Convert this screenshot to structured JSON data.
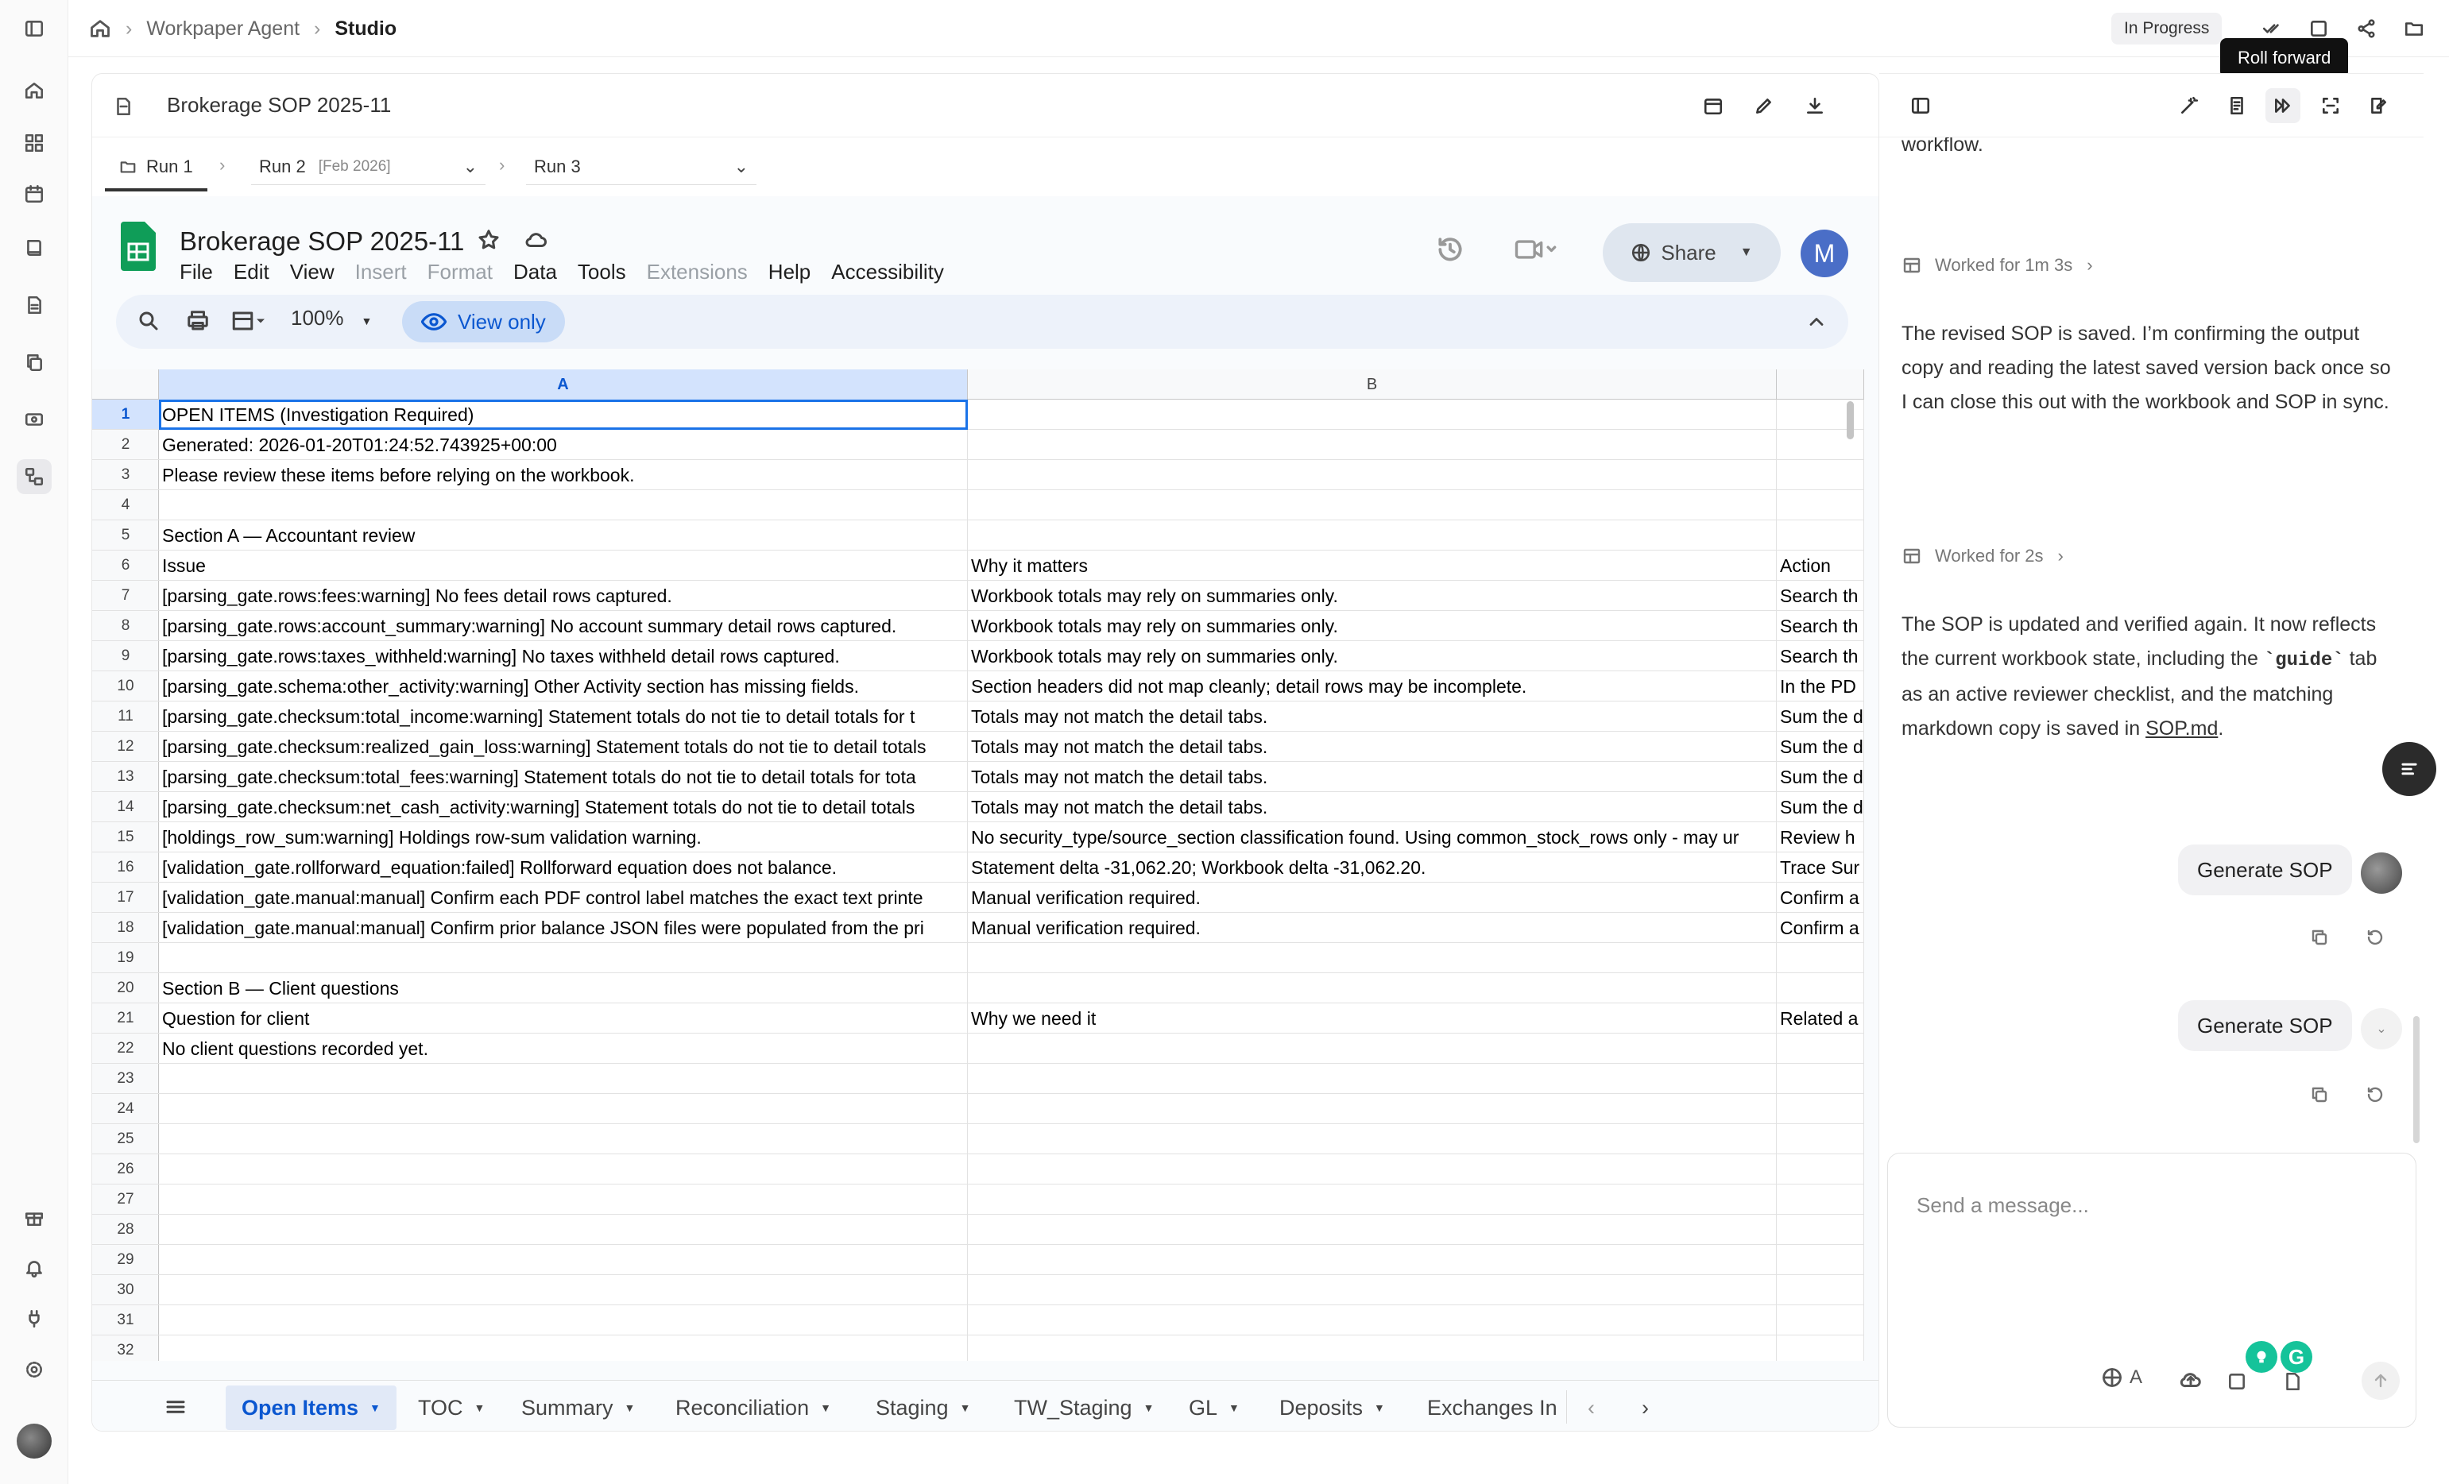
{
  "breadcrumb": {
    "home": "home-icon",
    "items": [
      "Workpaper Agent",
      "Studio"
    ]
  },
  "status": "In Progress",
  "tooltip": "Roll forward",
  "doc": {
    "title": "Brokerage SOP 2025-11"
  },
  "runs": [
    {
      "label": "Run 1",
      "tag": ""
    },
    {
      "label": "Run 2",
      "tag": "[Feb 2026]"
    },
    {
      "label": "Run 3",
      "tag": ""
    }
  ],
  "sheets": {
    "title": "Brokerage SOP 2025-11",
    "menu": [
      "File",
      "Edit",
      "View",
      "Insert",
      "Format",
      "Data",
      "Tools",
      "Extensions",
      "Help",
      "Accessibility"
    ],
    "menu_disabled": [
      "Insert",
      "Format",
      "Extensions"
    ],
    "share": "Share",
    "avatar": "M",
    "zoom": "100%",
    "view_only": "View only",
    "columns": [
      "A",
      "B"
    ],
    "row_numbers": [
      "1",
      "2",
      "3",
      "4",
      "5",
      "6",
      "7",
      "8",
      "9",
      "10",
      "11",
      "12",
      "13",
      "14",
      "15",
      "16",
      "17",
      "18",
      "19",
      "20",
      "21",
      "22",
      "23",
      "24",
      "25",
      "26",
      "27",
      "28",
      "29",
      "30",
      "31",
      "32"
    ],
    "rows": [
      [
        "OPEN ITEMS (Investigation Required)",
        "",
        ""
      ],
      [
        "Generated: 2026-01-20T01:24:52.743925+00:00",
        "",
        ""
      ],
      [
        "Please review these items before relying on the workbook.",
        "",
        ""
      ],
      [
        "",
        "",
        ""
      ],
      [
        "Section A — Accountant review",
        "",
        ""
      ],
      [
        "Issue",
        "Why it matters",
        "Action"
      ],
      [
        "[parsing_gate.rows:fees:warning] No fees detail rows captured.",
        "Workbook totals may rely on summaries only.",
        "Search th"
      ],
      [
        "[parsing_gate.rows:account_summary:warning] No account summary detail rows captured.",
        "Workbook totals may rely on summaries only.",
        "Search th"
      ],
      [
        "[parsing_gate.rows:taxes_withheld:warning] No taxes withheld detail rows captured.",
        "Workbook totals may rely on summaries only.",
        "Search th"
      ],
      [
        "[parsing_gate.schema:other_activity:warning] Other Activity section has missing fields.",
        "Section headers did not map cleanly; detail rows may be incomplete.",
        "In the PD"
      ],
      [
        "[parsing_gate.checksum:total_income:warning] Statement totals do not tie to detail totals for t",
        "Totals may not match the detail tabs.",
        "Sum the d"
      ],
      [
        "[parsing_gate.checksum:realized_gain_loss:warning] Statement totals do not tie to detail totals",
        "Totals may not match the detail tabs.",
        "Sum the d"
      ],
      [
        "[parsing_gate.checksum:total_fees:warning] Statement totals do not tie to detail totals for tota",
        "Totals may not match the detail tabs.",
        "Sum the d"
      ],
      [
        "[parsing_gate.checksum:net_cash_activity:warning] Statement totals do not tie to detail totals",
        "Totals may not match the detail tabs.",
        "Sum the d"
      ],
      [
        "[holdings_row_sum:warning] Holdings row-sum validation warning.",
        "No security_type/source_section classification found. Using common_stock_rows only - may ur",
        "Review h"
      ],
      [
        "[validation_gate.rollforward_equation:failed] Rollforward equation does not balance.",
        "Statement delta -31,062.20; Workbook delta -31,062.20.",
        "Trace Sur"
      ],
      [
        "[validation_gate.manual:manual] Confirm each PDF control label matches the exact text printe",
        "Manual verification required.",
        "Confirm a"
      ],
      [
        "[validation_gate.manual:manual] Confirm prior balance JSON files were populated from the pri",
        "Manual verification required.",
        "Confirm a"
      ],
      [
        "",
        "",
        ""
      ],
      [
        "Section B — Client questions",
        "",
        ""
      ],
      [
        "Question for client",
        "Why we need it",
        "Related a"
      ],
      [
        "No client questions recorded yet.",
        "",
        ""
      ],
      [
        "",
        "",
        ""
      ],
      [
        "",
        "",
        ""
      ],
      [
        "",
        "",
        ""
      ],
      [
        "",
        "",
        ""
      ],
      [
        "",
        "",
        ""
      ],
      [
        "",
        "",
        ""
      ],
      [
        "",
        "",
        ""
      ],
      [
        "",
        "",
        ""
      ],
      [
        "",
        "",
        ""
      ],
      [
        "",
        "",
        ""
      ]
    ],
    "tabs": [
      "Open Items",
      "TOC",
      "Summary",
      "Reconciliation",
      "Staging",
      "TW_Staging",
      "GL",
      "Deposits",
      "Exchanges In"
    ]
  },
  "chat": {
    "fragment": "workflow.",
    "worked1": "Worked for 1m 3s",
    "msg1": "The revised SOP is saved. I’m confirming the output copy and reading the latest saved version back once so I can close this out with the workbook and SOP in sync.",
    "worked2": "Worked for 2s",
    "msg2_a": "The SOP is updated and verified again. It now reflects the current workbook state, including the",
    "msg2_code": "`guide`",
    "msg2_b": "tab as an active reviewer checklist, and the matching markdown copy is saved in",
    "msg2_link": "SOP.md",
    "msg2_end": ".",
    "user_msgs": [
      "Generate SOP",
      "Generate SOP"
    ],
    "placeholder": "Send a message...",
    "lang": "A"
  },
  "colors": {
    "accent": "#0b57d0",
    "sheets_green": "#0f9d58",
    "selection": "#1a73e8"
  }
}
